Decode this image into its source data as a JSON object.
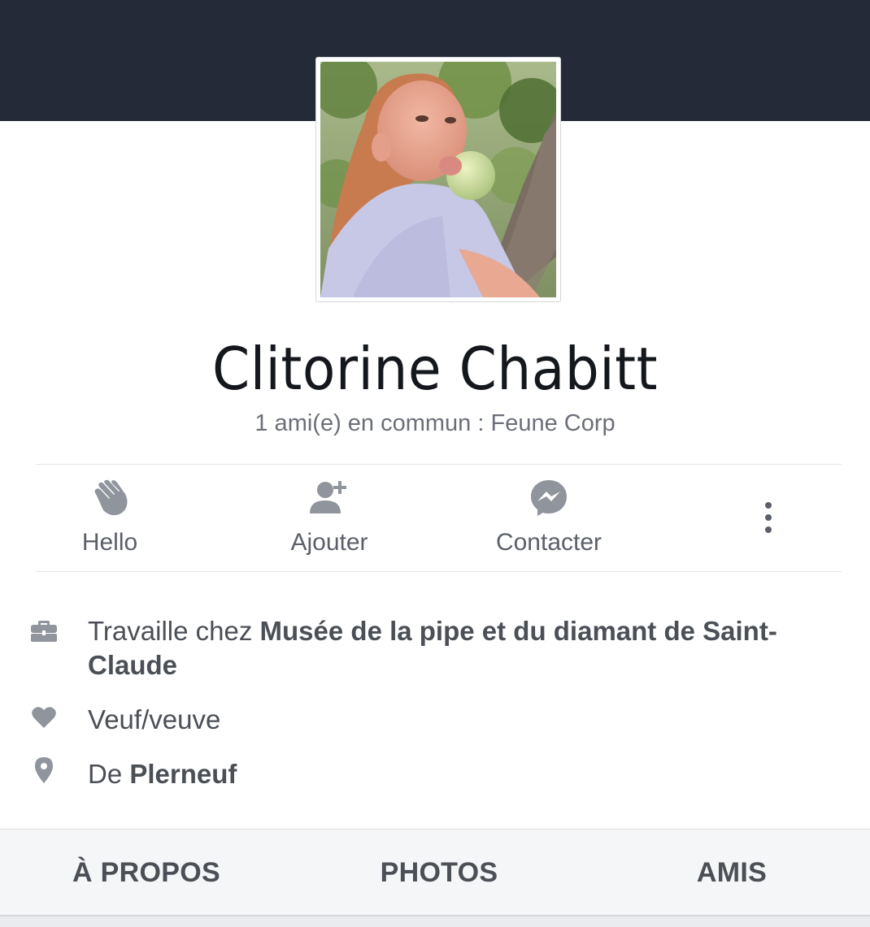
{
  "profile": {
    "name": "Clitorine Chabitt",
    "mutual_friends": "1 ami(e) en commun : Feune Corp"
  },
  "actions": [
    {
      "label": "Hello",
      "icon": "wave-hand-icon"
    },
    {
      "label": "Ajouter",
      "icon": "add-friend-icon"
    },
    {
      "label": "Contacter",
      "icon": "messenger-icon"
    },
    {
      "label": "",
      "icon": "more-vertical-icon"
    }
  ],
  "info": {
    "work_prefix": "Travaille chez ",
    "work_place": "Musée de la pipe et du diamant de Saint-Claude",
    "relationship": "Veuf/veuve",
    "hometown_prefix": "De ",
    "hometown": "Plerneuf"
  },
  "tabs": [
    {
      "label": "À PROPOS"
    },
    {
      "label": "PHOTOS"
    },
    {
      "label": "AMIS"
    }
  ],
  "colors": {
    "cover": "#252a38",
    "icon_gray": "#90949c",
    "text_gray": "#4b4f56",
    "tabbar_bg": "#f5f6f7"
  }
}
